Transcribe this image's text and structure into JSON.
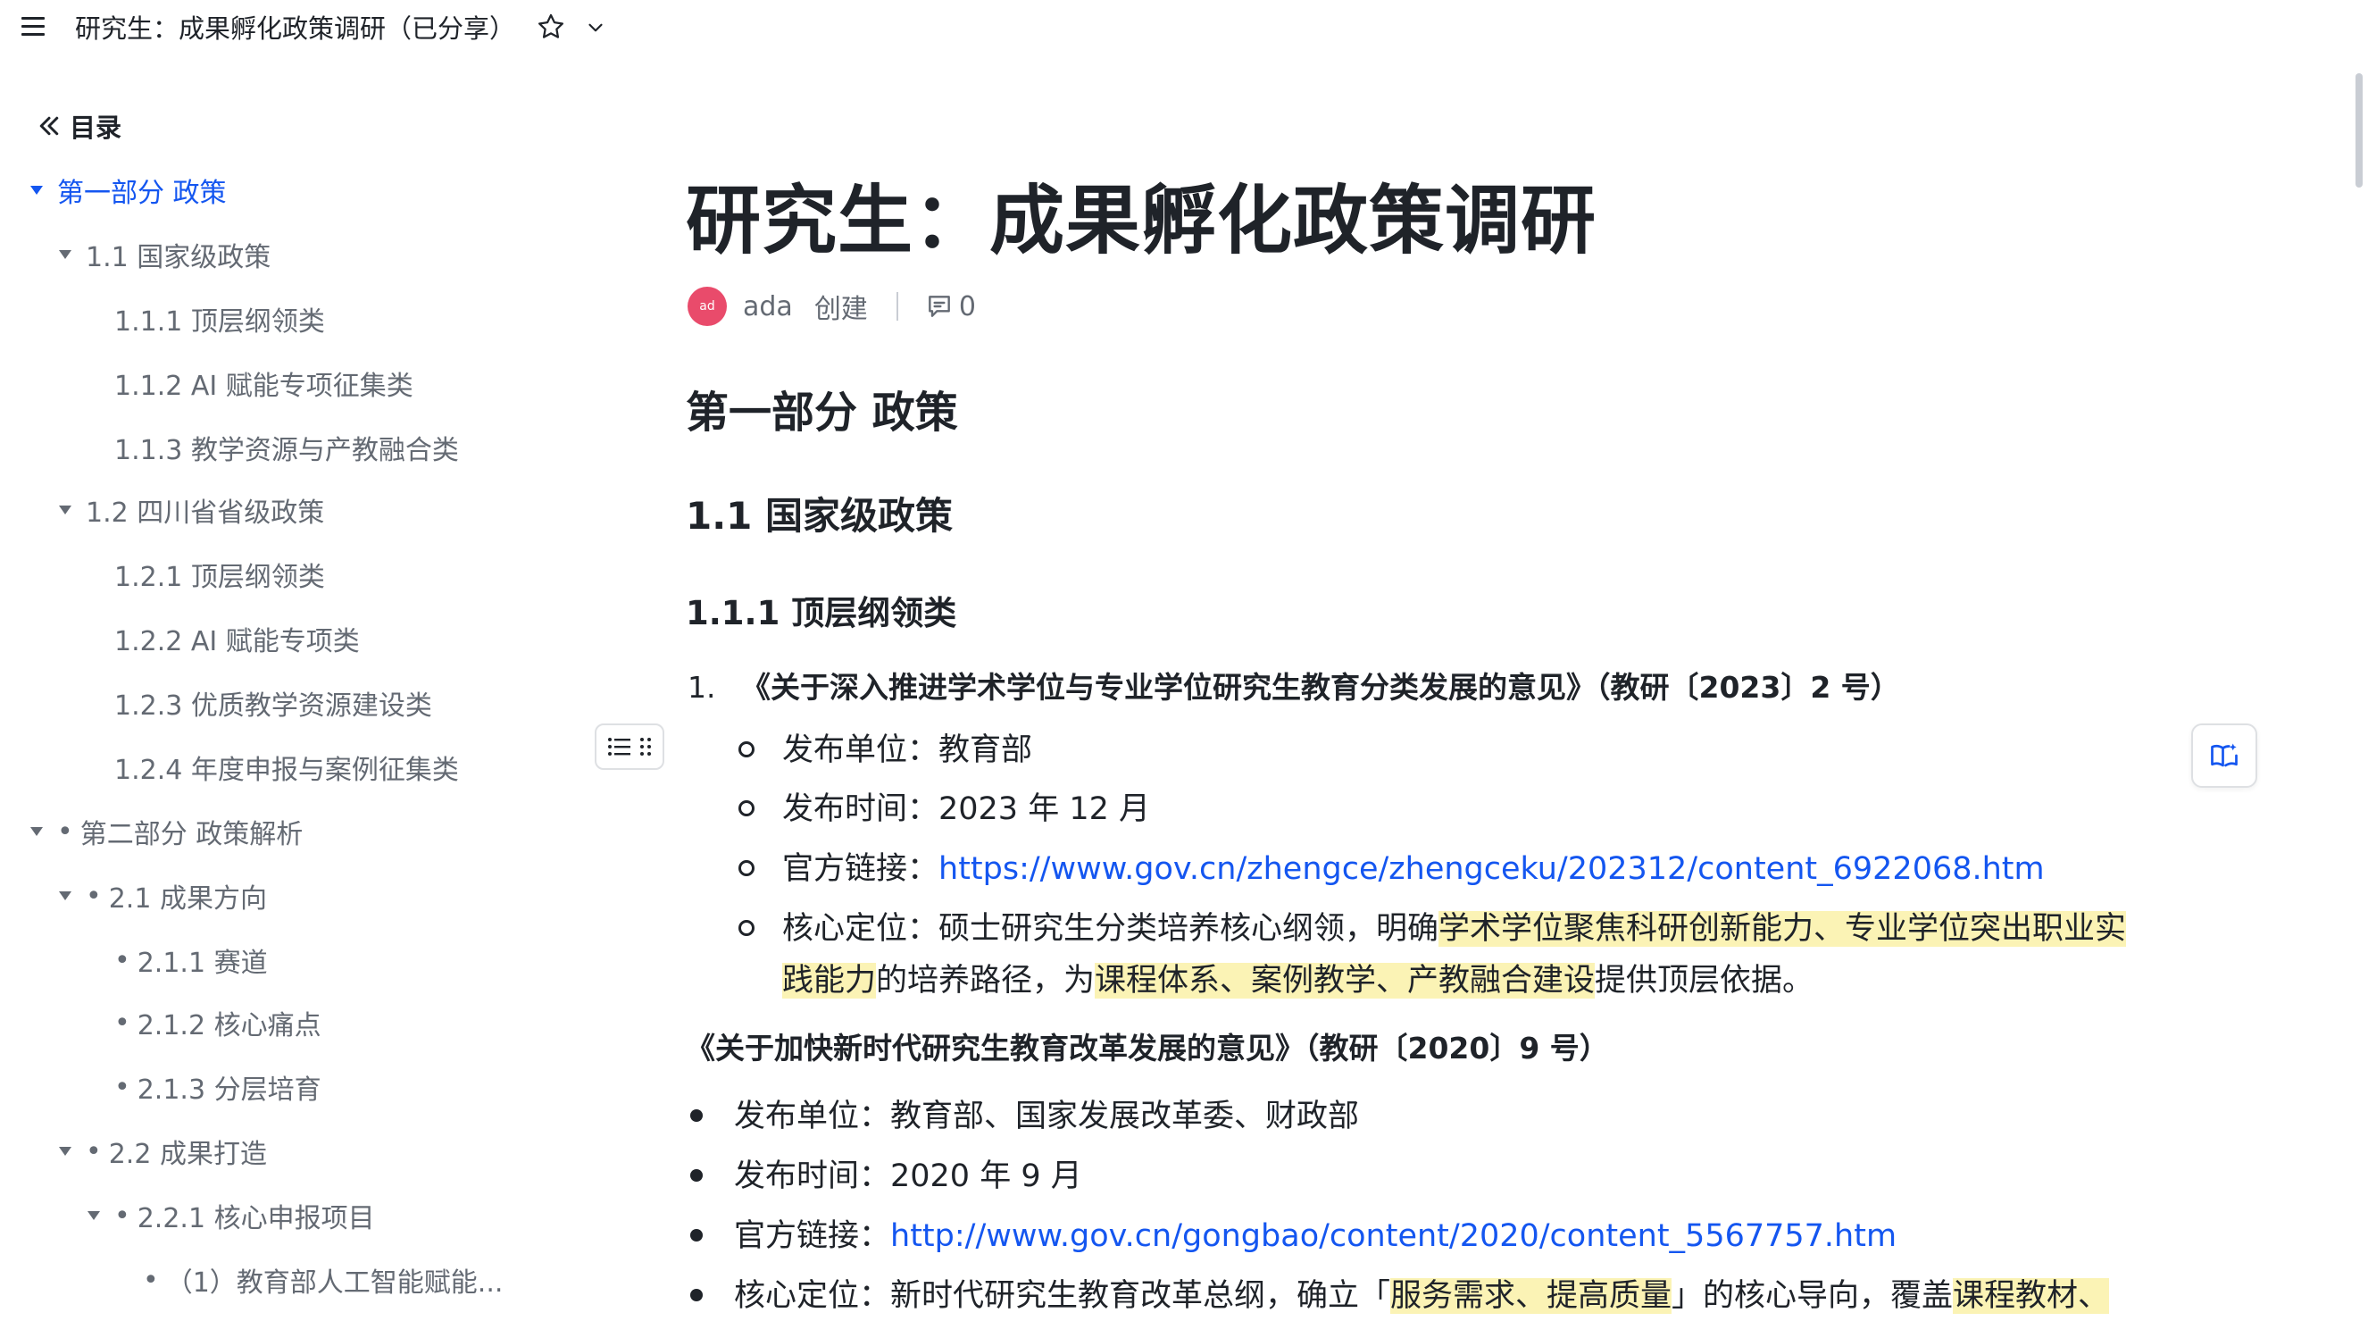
{
  "topbar": {
    "title": "研究生：成果孵化政策调研（已分享）",
    "menu_icon": "hamburger-menu-icon",
    "star_icon": "star-outline-icon",
    "dropdown_icon": "chevron-down-icon"
  },
  "sidebar": {
    "toc_label": "目录",
    "items": [
      {
        "label": "第一部分 政策",
        "prefix": ""
      },
      {
        "label": "1.1 国家级政策",
        "prefix": ""
      },
      {
        "label": "1.1.1 顶层纲领类",
        "prefix": ""
      },
      {
        "label": "1.1.2 AI 赋能专项征集类",
        "prefix": ""
      },
      {
        "label": "1.1.3 教学资源与产教融合类",
        "prefix": ""
      },
      {
        "label": "1.2 四川省省级政策",
        "prefix": ""
      },
      {
        "label": "1.2.1 顶层纲领类",
        "prefix": ""
      },
      {
        "label": "1.2.2 AI 赋能专项类",
        "prefix": ""
      },
      {
        "label": "1.2.3 优质教学资源建设类",
        "prefix": ""
      },
      {
        "label": "1.2.4 年度申报与案例征集类",
        "prefix": ""
      },
      {
        "label": "第二部分 政策解析",
        "prefix": "•"
      },
      {
        "label": "2.1 成果方向",
        "prefix": "•"
      },
      {
        "label": "2.1.1 赛道",
        "prefix": "•"
      },
      {
        "label": "2.1.2 核心痛点",
        "prefix": "•"
      },
      {
        "label": "2.1.3 分层培育",
        "prefix": "•"
      },
      {
        "label": "2.2 成果打造",
        "prefix": "•"
      },
      {
        "label": "2.2.1 核心申报项目",
        "prefix": "•"
      },
      {
        "label": "（1）教育部人工智能赋能...",
        "prefix": "•"
      }
    ]
  },
  "document": {
    "title": "研究生：成果孵化政策调研",
    "meta": {
      "avatar_text": "ad",
      "author": "ada",
      "action": "创建",
      "comment_count": "0"
    },
    "h2": "第一部分 政策",
    "h3": "1.1 国家级政策",
    "h4": "1.1.1 顶层纲领类",
    "policy1": {
      "number": "1.",
      "title": "《关于深入推进学术学位与专业学位研究生教育分类发展的意见》（教研〔2023〕2 号）",
      "issuer": "发布单位：教育部",
      "date": "发布时间：2023 年 12 月",
      "link_label": "官方链接：",
      "link": "https://www.gov.cn/zhengce/zhengceku/202312/content_6922068.htm",
      "core_a": "核心定位：硕士研究生分类培养核心纲领，明确",
      "core_hl1": "学术学位聚焦科研创新能力、专业学位突出职业实",
      "core_hl1b": "践能力",
      "core_b": "的培养路径，为",
      "core_hl2": "课程体系、案例教学、产教融合建设",
      "core_c": "提供顶层依据。"
    },
    "policy2": {
      "title": "《关于加快新时代研究生教育改革发展的意见》（教研〔2020〕9 号）",
      "issuer": "发布单位：教育部、国家发展改革委、财政部",
      "date": "发布时间：2020 年 9 月",
      "link_label": "官方链接：",
      "link": "http://www.gov.cn/gongbao/content/2020/content_5567757.htm",
      "core_a": "核心定位：新时代研究生教育改革总纲，确立「",
      "core_hl1": "服务需求、提高质量",
      "core_b": "」的核心导向，覆盖",
      "core_hl2": "课程教材、"
    }
  },
  "right": {
    "float_icon": "book-sparkle-icon"
  },
  "colors": {
    "link": "#1456f0",
    "highlight": "#fbf3b5",
    "avatar": "#e94b6b",
    "text": "#1f2329",
    "muted": "#646a73"
  }
}
